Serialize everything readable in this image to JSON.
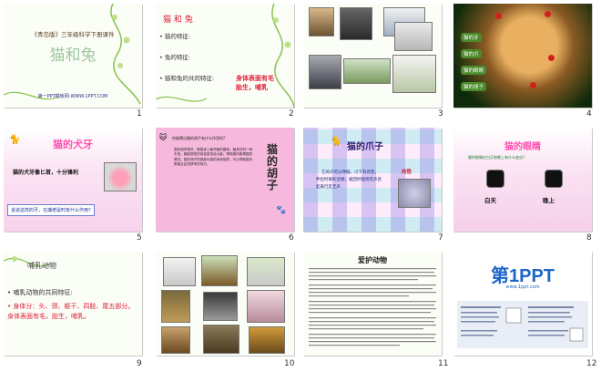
{
  "slides": [
    {
      "number": "1",
      "series": "《青岛版》三年级科学下册课件",
      "title": "猫和兔",
      "footer": "第一PPT模板网-WWW.1PPT.COM"
    },
    {
      "number": "2",
      "title": "猫 和 兔",
      "items": [
        "猫的特征:",
        "兔的特征:",
        "猫和兔的共同特征:"
      ],
      "answer_line1": "身体表面有毛",
      "answer_line2": "胎生，哺乳"
    },
    {
      "number": "3"
    },
    {
      "number": "4",
      "labels": [
        "猫的牙",
        "猫的爪",
        "猫的眼睛",
        "猫的胡子"
      ]
    },
    {
      "number": "5",
      "title": "猫的犬牙",
      "body": "猫的犬牙像匕首，十分锋利",
      "question": "说说这样的牙，在捕老鼠时有什么作用?"
    },
    {
      "number": "6",
      "question": "你能猜出猫的胡子有什么作用吗?",
      "vertical_title": [
        "猫",
        "的",
        "胡",
        "子"
      ],
      "body": "猫的胡须很灵，是猫身上最灵敏的器官。触到任何一种东西，都能很快的将信息传给大脑，帮助猫判断周围的情况。猫的胡子的宽度与猫的身体相同，可以帮助猫判断能否钻进狭窄的地方。"
    },
    {
      "number": "7",
      "title": "猫的爪子",
      "body_line1": "它的爪可以伸缩，爪下有肉垫，",
      "body_line2": "伸出时锋利坚硬，缩回时能悄无声息",
      "body_line3": "起来行走无声",
      "label": "肉垫"
    },
    {
      "number": "8",
      "title": "猫的眼睛",
      "subtitle": "猫的眼睛在白天和晚上有什么变化?",
      "label_day": "白天",
      "label_night": "晚上"
    },
    {
      "number": "9",
      "title": "哺乳动物",
      "common": "哺乳动物的共同特征:",
      "features": "身体分：头、颈、躯干、四肢、尾五部分。身体表面有毛，胎生，哺乳。"
    },
    {
      "number": "10"
    },
    {
      "number": "11",
      "title": "爱护动物"
    },
    {
      "number": "12",
      "logo_text": "第1PPT",
      "tagline": "www.1ppt.com"
    }
  ],
  "colors": {
    "pink": "#ff4fb0",
    "red": "#e0203a",
    "purple": "#9b2fa0",
    "brand_blue": "#1b66c9"
  }
}
